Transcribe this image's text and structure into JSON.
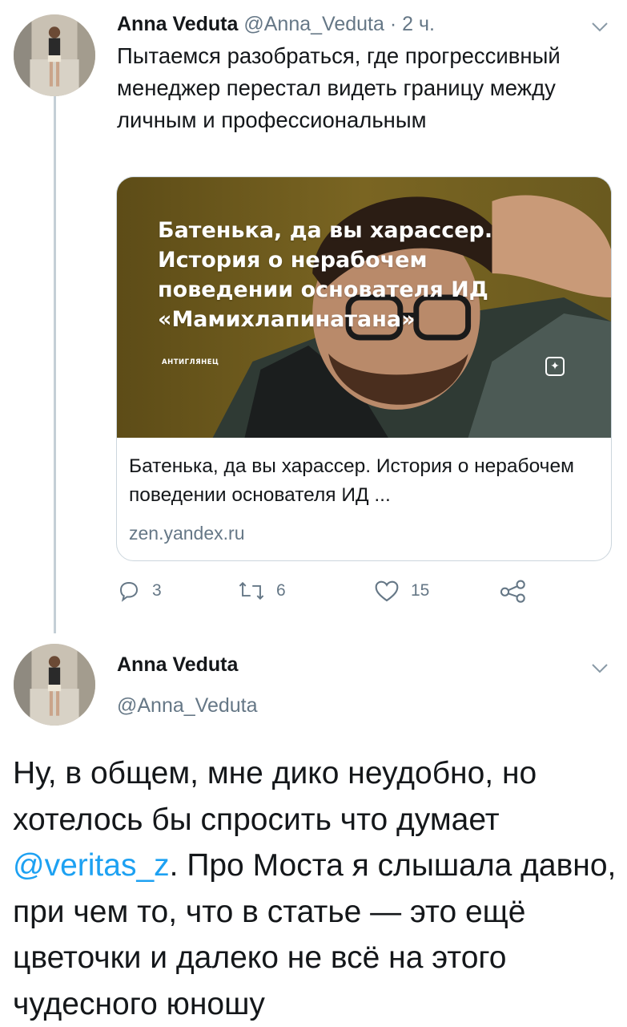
{
  "tweet1": {
    "author_name": "Anna Veduta",
    "author_handle": "@Anna_Veduta",
    "separator": "·",
    "time": "2 ч.",
    "text": "Пытаемся разобраться, где прогрессивный менеджер перестал видеть границу между личным и профессиональным",
    "card": {
      "image_headline": "Батенька, да вы харассер. История о нерабочем поведении основателя ИД «Мамихлапинатана»",
      "image_source": "АНТИГЛЯНЕЦ",
      "title": "Батенька, да вы харассер. История о нерабочем поведении основателя ИД ...",
      "domain": "zen.yandex.ru"
    },
    "actions": {
      "replies": "3",
      "retweets": "6",
      "likes": "15"
    }
  },
  "tweet2": {
    "author_name": "Anna Veduta",
    "author_handle": "@Anna_Veduta",
    "text_before_mention": "Ну, в общем, мне дико неудобно, но хотелось бы спросить что думает ",
    "mention": "@veritas_z",
    "text_after_mention": ". Про Моста я слышала давно, при чем то, что в статье — это ещё цветочки и далеко не всё на этого чудесного юношу"
  },
  "colors": {
    "text": "#14171a",
    "muted": "#657786",
    "link": "#1da1f2",
    "border": "#ccd6dd",
    "thread_line": "#c4cfd6",
    "card_image_bg": "#6e5b1d"
  },
  "icons": [
    "chevron-down-icon",
    "reply-icon",
    "retweet-icon",
    "like-icon",
    "share-icon",
    "zen-icon"
  ]
}
